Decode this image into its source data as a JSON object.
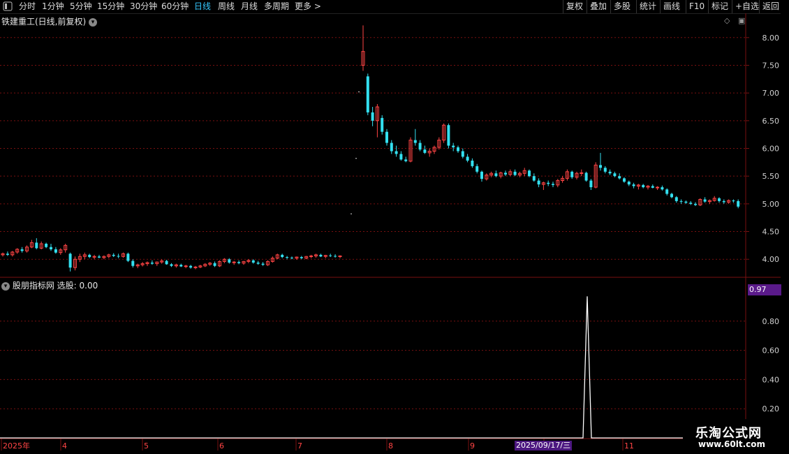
{
  "toolbar": {
    "periods": [
      "分时",
      "1分钟",
      "5分钟",
      "15分钟",
      "30分钟",
      "60分钟",
      "日线",
      "周线",
      "月线",
      "多周期",
      "更多 >"
    ],
    "active_period": "日线",
    "right_buttons": [
      "复权",
      "叠加",
      "多股",
      "统计",
      "画线",
      "F10",
      "标记",
      "+自选",
      "返回"
    ]
  },
  "main_chart": {
    "title": "铁建重工(日线,前复权)",
    "y_ticks": [
      "8.00",
      "7.50",
      "7.00",
      "6.50",
      "6.00",
      "5.50",
      "5.00",
      "4.50",
      "4.00"
    ]
  },
  "indicator": {
    "title": "股朋指标网 选股: 0.00",
    "current_value_label": "0.97",
    "y_ticks": [
      "0.80",
      "0.60",
      "0.40",
      "0.20"
    ]
  },
  "x_axis": {
    "labels": [
      "2025年",
      "4",
      "5",
      "6",
      "7",
      "8",
      "9",
      "10",
      "11"
    ],
    "cursor_date": "2025/09/17/三"
  },
  "watermark": {
    "line1": "乐淘公式网",
    "line2": "www.60lt.com"
  },
  "colors": {
    "up": "#ff4444",
    "down": "#33e0f0",
    "grid": "#7a1010",
    "axis_text": "#d0d0d0",
    "active_tab": "#35c8ff",
    "cursor_label_bg": "#4c1780"
  },
  "chart_data": {
    "type": "candlestick",
    "price_range": [
      3.7,
      8.3
    ],
    "indicator_range": [
      0,
      1.0
    ],
    "candles": [
      [
        4.08,
        4.12,
        4.05,
        4.1
      ],
      [
        4.1,
        4.14,
        4.06,
        4.08
      ],
      [
        4.08,
        4.15,
        4.05,
        4.13
      ],
      [
        4.13,
        4.2,
        4.1,
        4.18
      ],
      [
        4.18,
        4.22,
        4.12,
        4.15
      ],
      [
        4.15,
        4.25,
        4.12,
        4.22
      ],
      [
        4.22,
        4.35,
        4.2,
        4.3
      ],
      [
        4.3,
        4.38,
        4.18,
        4.2
      ],
      [
        4.2,
        4.32,
        4.18,
        4.28
      ],
      [
        4.28,
        4.3,
        4.2,
        4.22
      ],
      [
        4.22,
        4.28,
        4.15,
        4.18
      ],
      [
        4.18,
        4.22,
        4.1,
        4.12
      ],
      [
        4.12,
        4.2,
        4.08,
        4.17
      ],
      [
        4.17,
        4.28,
        4.12,
        4.25
      ],
      [
        4.1,
        4.12,
        3.78,
        3.85
      ],
      [
        3.85,
        4.05,
        3.8,
        4.0
      ],
      [
        4.0,
        4.1,
        3.95,
        4.05
      ],
      [
        4.05,
        4.12,
        4.0,
        4.08
      ],
      [
        4.08,
        4.1,
        4.02,
        4.04
      ],
      [
        4.04,
        4.08,
        4.0,
        4.05
      ],
      [
        4.05,
        4.08,
        4.02,
        4.03
      ],
      [
        4.03,
        4.07,
        4.0,
        4.05
      ],
      [
        4.05,
        4.1,
        4.02,
        4.08
      ],
      [
        4.08,
        4.11,
        4.04,
        4.06
      ],
      [
        4.06,
        4.1,
        4.02,
        4.05
      ],
      [
        4.05,
        4.12,
        4.03,
        4.1
      ],
      [
        4.1,
        4.12,
        3.95,
        3.97
      ],
      [
        3.97,
        4.0,
        3.85,
        3.88
      ],
      [
        3.88,
        3.92,
        3.84,
        3.9
      ],
      [
        3.9,
        3.95,
        3.87,
        3.92
      ],
      [
        3.92,
        3.96,
        3.88,
        3.94
      ],
      [
        3.94,
        3.98,
        3.9,
        3.92
      ],
      [
        3.92,
        3.96,
        3.88,
        3.95
      ],
      [
        3.95,
        4.0,
        3.92,
        3.97
      ],
      [
        3.97,
        3.99,
        3.9,
        3.91
      ],
      [
        3.91,
        3.93,
        3.86,
        3.88
      ],
      [
        3.88,
        3.92,
        3.85,
        3.9
      ],
      [
        3.9,
        3.92,
        3.86,
        3.87
      ],
      [
        3.87,
        3.9,
        3.84,
        3.88
      ],
      [
        3.88,
        3.9,
        3.83,
        3.85
      ],
      [
        3.85,
        3.88,
        3.82,
        3.86
      ],
      [
        3.86,
        3.9,
        3.84,
        3.88
      ],
      [
        3.88,
        3.93,
        3.86,
        3.91
      ],
      [
        3.91,
        3.95,
        3.88,
        3.93
      ],
      [
        3.93,
        3.96,
        3.86,
        3.88
      ],
      [
        3.88,
        3.98,
        3.86,
        3.96
      ],
      [
        3.96,
        4.02,
        3.93,
        4.0
      ],
      [
        4.0,
        4.02,
        3.92,
        3.94
      ],
      [
        3.94,
        3.97,
        3.9,
        3.95
      ],
      [
        3.95,
        3.98,
        3.91,
        3.93
      ],
      [
        3.93,
        3.97,
        3.9,
        3.96
      ],
      [
        3.96,
        4.0,
        3.93,
        3.98
      ],
      [
        3.98,
        4.0,
        3.92,
        3.94
      ],
      [
        3.94,
        3.97,
        3.9,
        3.92
      ],
      [
        3.92,
        3.95,
        3.88,
        3.9
      ],
      [
        3.9,
        3.98,
        3.88,
        3.96
      ],
      [
        3.96,
        4.05,
        3.94,
        4.02
      ],
      [
        4.02,
        4.1,
        4.0,
        4.08
      ],
      [
        4.08,
        4.1,
        4.02,
        4.04
      ],
      [
        4.04,
        4.06,
        4.0,
        4.03
      ],
      [
        4.03,
        4.05,
        4.0,
        4.02
      ],
      [
        4.02,
        4.05,
        3.99,
        4.04
      ],
      [
        4.04,
        4.06,
        4.0,
        4.02
      ],
      [
        4.02,
        4.06,
        4.0,
        4.05
      ],
      [
        4.05,
        4.08,
        4.02,
        4.06
      ],
      [
        4.06,
        4.1,
        4.03,
        4.08
      ],
      [
        4.08,
        4.1,
        4.04,
        4.05
      ],
      [
        4.05,
        4.08,
        4.02,
        4.07
      ],
      [
        4.07,
        4.1,
        4.04,
        4.06
      ],
      [
        4.06,
        4.09,
        4.03,
        4.05
      ],
      [
        4.05,
        4.07,
        4.02,
        4.06
      ]
    ],
    "gap_marks": [
      [
        5.82
      ],
      [
        4.82
      ],
      [
        7.02
      ]
    ],
    "candles2": [
      [
        7.5,
        8.22,
        7.4,
        7.75
      ],
      [
        7.3,
        7.35,
        6.6,
        6.65
      ],
      [
        6.65,
        6.75,
        6.4,
        6.5
      ],
      [
        6.5,
        6.8,
        6.2,
        6.75
      ],
      [
        6.55,
        6.6,
        6.25,
        6.3
      ],
      [
        6.3,
        6.35,
        6.05,
        6.1
      ],
      [
        6.1,
        6.15,
        5.9,
        5.95
      ],
      [
        5.95,
        6.05,
        5.85,
        5.9
      ],
      [
        5.9,
        5.95,
        5.78,
        5.8
      ],
      [
        5.8,
        5.85,
        5.75,
        5.77
      ],
      [
        5.77,
        6.2,
        5.75,
        6.15
      ],
      [
        6.15,
        6.35,
        6.05,
        6.1
      ],
      [
        6.1,
        6.15,
        5.95,
        5.98
      ],
      [
        5.98,
        6.05,
        5.9,
        5.92
      ],
      [
        5.92,
        6.0,
        5.85,
        5.95
      ],
      [
        5.95,
        6.05,
        5.9,
        6.02
      ],
      [
        6.02,
        6.2,
        5.98,
        6.15
      ],
      [
        6.15,
        6.45,
        6.1,
        6.42
      ],
      [
        6.42,
        6.45,
        6.0,
        6.05
      ],
      [
        6.05,
        6.1,
        5.95,
        6.02
      ],
      [
        6.02,
        6.05,
        5.92,
        5.95
      ],
      [
        5.95,
        6.0,
        5.82,
        5.85
      ],
      [
        5.85,
        5.9,
        5.75,
        5.78
      ],
      [
        5.78,
        5.82,
        5.65,
        5.68
      ],
      [
        5.68,
        5.72,
        5.55,
        5.58
      ],
      [
        5.58,
        5.6,
        5.4,
        5.45
      ],
      [
        5.45,
        5.55,
        5.42,
        5.52
      ],
      [
        5.52,
        5.58,
        5.48,
        5.55
      ],
      [
        5.55,
        5.6,
        5.48,
        5.5
      ],
      [
        5.5,
        5.58,
        5.46,
        5.56
      ],
      [
        5.56,
        5.6,
        5.5,
        5.53
      ],
      [
        5.53,
        5.62,
        5.5,
        5.58
      ],
      [
        5.58,
        5.62,
        5.5,
        5.52
      ],
      [
        5.52,
        5.58,
        5.48,
        5.55
      ],
      [
        5.55,
        5.65,
        5.5,
        5.6
      ],
      [
        5.6,
        5.62,
        5.48,
        5.5
      ],
      [
        5.5,
        5.55,
        5.4,
        5.42
      ],
      [
        5.42,
        5.46,
        5.3,
        5.35
      ],
      [
        5.35,
        5.4,
        5.25,
        5.38
      ],
      [
        5.38,
        5.42,
        5.32,
        5.36
      ],
      [
        5.36,
        5.4,
        5.3,
        5.34
      ],
      [
        5.34,
        5.45,
        5.3,
        5.42
      ],
      [
        5.42,
        5.5,
        5.38,
        5.46
      ],
      [
        5.46,
        5.62,
        5.42,
        5.58
      ],
      [
        5.58,
        5.6,
        5.45,
        5.48
      ],
      [
        5.48,
        5.58,
        5.44,
        5.55
      ],
      [
        5.55,
        5.62,
        5.5,
        5.56
      ],
      [
        5.56,
        5.58,
        5.4,
        5.42
      ],
      [
        5.42,
        5.45,
        5.25,
        5.3
      ],
      [
        5.3,
        5.75,
        5.28,
        5.7
      ],
      [
        5.7,
        5.92,
        5.6,
        5.65
      ],
      [
        5.65,
        5.68,
        5.55,
        5.58
      ],
      [
        5.58,
        5.62,
        5.52,
        5.55
      ],
      [
        5.55,
        5.58,
        5.48,
        5.5
      ],
      [
        5.5,
        5.55,
        5.44,
        5.46
      ],
      [
        5.46,
        5.48,
        5.38,
        5.4
      ],
      [
        5.4,
        5.42,
        5.32,
        5.35
      ],
      [
        5.35,
        5.38,
        5.28,
        5.32
      ],
      [
        5.32,
        5.36,
        5.26,
        5.34
      ],
      [
        5.34,
        5.36,
        5.28,
        5.3
      ],
      [
        5.3,
        5.34,
        5.26,
        5.32
      ],
      [
        5.32,
        5.35,
        5.28,
        5.29
      ],
      [
        5.29,
        5.32,
        5.25,
        5.3
      ],
      [
        5.3,
        5.33,
        5.24,
        5.26
      ],
      [
        5.26,
        5.28,
        5.15,
        5.18
      ],
      [
        5.18,
        5.2,
        5.1,
        5.12
      ],
      [
        5.12,
        5.14,
        5.02,
        5.05
      ],
      [
        5.05,
        5.08,
        5.0,
        5.04
      ],
      [
        5.04,
        5.06,
        5.0,
        5.02
      ],
      [
        5.02,
        5.05,
        4.98,
        5.0
      ],
      [
        5.0,
        5.03,
        4.96,
        4.98
      ],
      [
        4.98,
        5.1,
        4.96,
        5.08
      ],
      [
        5.08,
        5.12,
        5.02,
        5.04
      ],
      [
        5.04,
        5.08,
        5.0,
        5.06
      ],
      [
        5.06,
        5.14,
        5.04,
        5.1
      ],
      [
        5.1,
        5.12,
        5.02,
        5.05
      ],
      [
        5.05,
        5.08,
        5.0,
        5.03
      ],
      [
        5.03,
        5.08,
        5.0,
        5.06
      ],
      [
        5.06,
        5.08,
        5.02,
        5.05
      ],
      [
        5.05,
        5.08,
        4.92,
        4.95
      ]
    ],
    "signal": {
      "peak_value": 0.97,
      "peak_x_label": "2025/09/17/三"
    }
  }
}
